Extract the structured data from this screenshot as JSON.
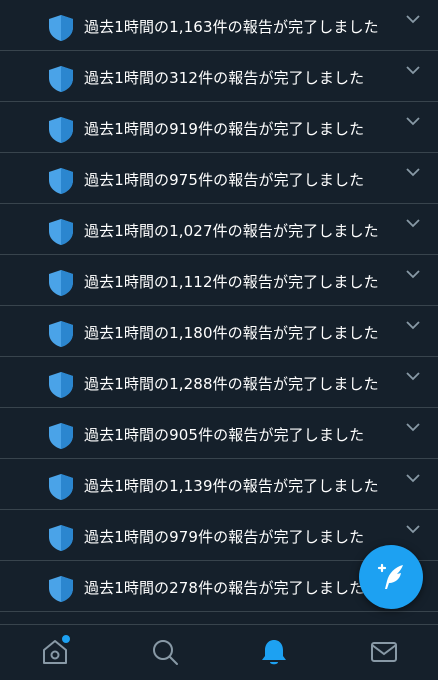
{
  "notifications": [
    {
      "text": "過去1時間の1,163件の報告が完了しました"
    },
    {
      "text": "過去1時間の312件の報告が完了しました"
    },
    {
      "text": "過去1時間の919件の報告が完了しました"
    },
    {
      "text": "過去1時間の975件の報告が完了しました"
    },
    {
      "text": "過去1時間の1,027件の報告が完了しました"
    },
    {
      "text": "過去1時間の1,112件の報告が完了しました"
    },
    {
      "text": "過去1時間の1,180件の報告が完了しました"
    },
    {
      "text": "過去1時間の1,288件の報告が完了しました"
    },
    {
      "text": "過去1時間の905件の報告が完了しました"
    },
    {
      "text": "過去1時間の1,139件の報告が完了しました"
    },
    {
      "text": "過去1時間の979件の報告が完了しました"
    },
    {
      "text": "過去1時間の278件の報告が完了しました"
    }
  ],
  "row_icon": "shield-icon",
  "row_menu_icon": "chevron-down-icon",
  "fab_icon": "compose-tweet-icon",
  "tabs": [
    {
      "name": "home",
      "icon": "home-icon",
      "active": false,
      "has_dot": true
    },
    {
      "name": "search",
      "icon": "search-icon",
      "active": false
    },
    {
      "name": "notifications",
      "icon": "bell-icon",
      "active": true
    },
    {
      "name": "messages",
      "icon": "mail-icon",
      "active": false
    }
  ],
  "colors": {
    "background": "#15202b",
    "divider": "#38444d",
    "accent": "#1da1f2",
    "shield": "#4aa3e8",
    "icon_inactive": "#8899a6"
  }
}
